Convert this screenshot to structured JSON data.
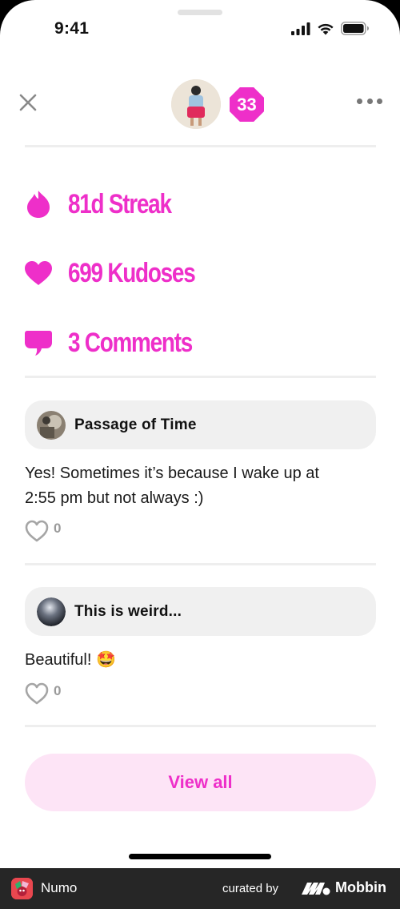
{
  "status_bar": {
    "time": "9:41"
  },
  "header": {
    "badge_count": "33"
  },
  "stats": [
    {
      "icon": "flame-icon",
      "label": "81d Streak"
    },
    {
      "icon": "heart-icon",
      "label": "699 Kudoses"
    },
    {
      "icon": "comment-bubble-icon",
      "label": "3 Comments"
    }
  ],
  "comments": [
    {
      "title": "Passage of Time",
      "body_line1": "Yes! Sometimes it’s because I wake up at",
      "body_line2": "2:55 pm but not always :)",
      "likes": "0"
    },
    {
      "title": "This is weird...",
      "body": "Beautiful! 🤩",
      "likes": "0"
    }
  ],
  "view_all_label": "View all",
  "footer": {
    "app_name": "Numo",
    "curated_by": "curated by",
    "brand": "Mobbin"
  },
  "colors": {
    "accent": "#ee2fc9",
    "accent_light": "#fde4f6",
    "card_bg": "#f0f0f0"
  }
}
